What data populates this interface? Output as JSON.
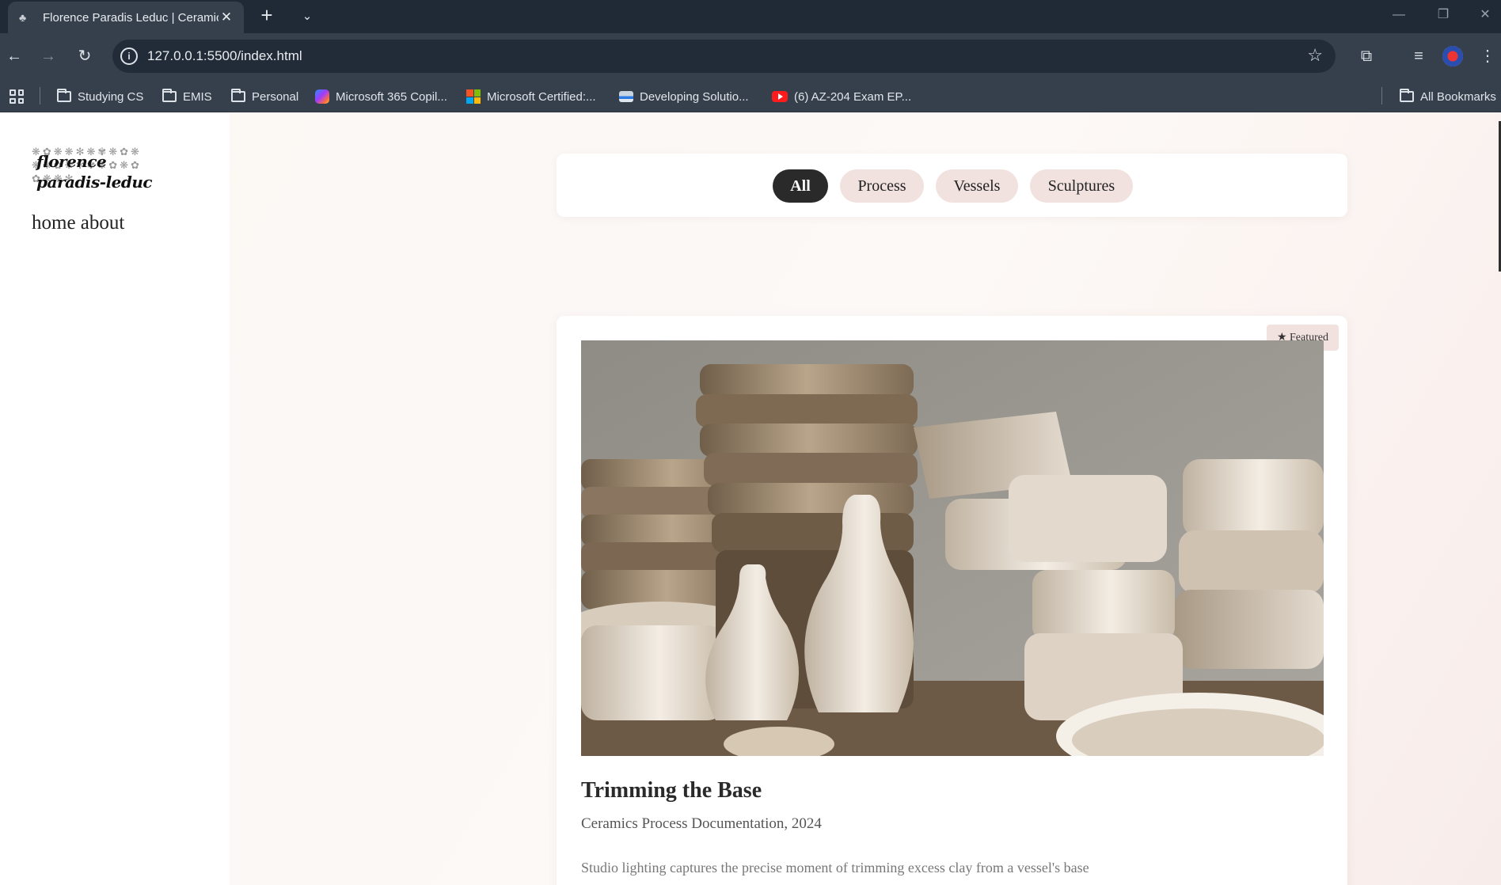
{
  "browser": {
    "tab_title": "Florence Paradis Leduc | Ceramics",
    "url": "127.0.0.1:5500/index.html",
    "bookmarks": [
      {
        "label": "Studying CS",
        "icon": "folder-icon"
      },
      {
        "label": "EMIS",
        "icon": "folder-icon"
      },
      {
        "label": "Personal",
        "icon": "folder-icon"
      },
      {
        "label": "Microsoft 365 Copil...",
        "icon": "copilot-icon"
      },
      {
        "label": "Microsoft Certified:...",
        "icon": "microsoft-icon"
      },
      {
        "label": "Developing Solutio...",
        "icon": "docs-icon"
      },
      {
        "label": "(6) AZ-204 Exam EP...",
        "icon": "youtube-icon"
      }
    ],
    "all_bookmarks": "All Bookmarks"
  },
  "site": {
    "logo_line1": "florence",
    "logo_line2": "paradis-leduc",
    "nav": {
      "home": "home",
      "about": "about"
    }
  },
  "filters": {
    "active": "All",
    "items": [
      "All",
      "Process",
      "Vessels",
      "Sculptures"
    ]
  },
  "featured": {
    "badge": "★ Featured",
    "title": "Trimming the Base",
    "subtitle": "Ceramics Process Documentation, 2024",
    "description": "Studio lighting captures the precise moment of trimming excess clay from a vessel's base"
  },
  "colors": {
    "chip_active": "#2a2a2a",
    "chip": "#f1e2e0",
    "badge": "#f1e2e0",
    "chrome": "#35404c"
  }
}
